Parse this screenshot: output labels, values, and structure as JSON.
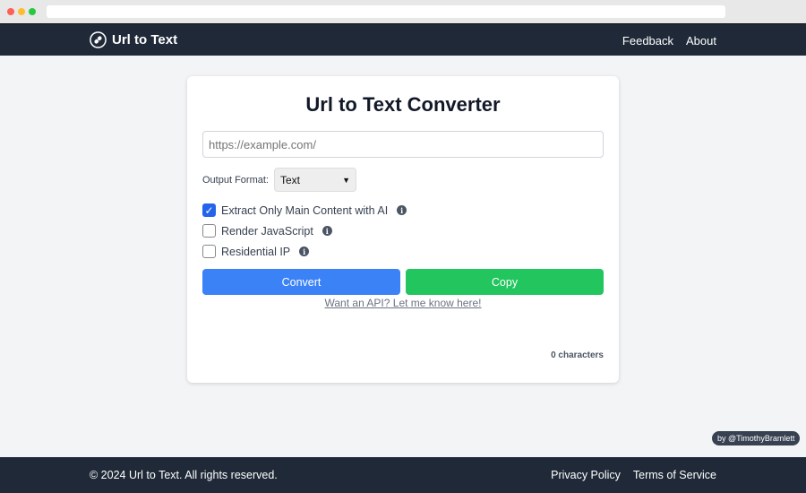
{
  "header": {
    "brand": "Url to Text",
    "links": [
      "Feedback",
      "About"
    ]
  },
  "main": {
    "title": "Url to Text Converter",
    "url_placeholder": "https://example.com/",
    "format_label": "Output Format:",
    "format_value": "Text",
    "options": [
      {
        "label": "Extract Only Main Content with AI",
        "checked": true
      },
      {
        "label": "Render JavaScript",
        "checked": false
      },
      {
        "label": "Residential IP",
        "checked": false
      }
    ],
    "convert_label": "Convert",
    "copy_label": "Copy",
    "api_link": "Want an API? Let me know here!",
    "char_count": "0 characters"
  },
  "badge": "by @TimothyBramlett",
  "footer": {
    "copyright": "© 2024 Url to Text. All rights reserved.",
    "links": [
      "Privacy Policy",
      "Terms of Service"
    ]
  },
  "colors": {
    "primary": "#3b82f6",
    "success": "#22c55e",
    "nav": "#1f2937"
  }
}
